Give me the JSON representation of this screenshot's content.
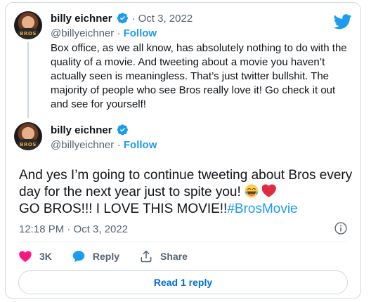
{
  "colors": {
    "accent": "#1d9bf0",
    "text": "#0f1419",
    "muted": "#536471",
    "heart": "#f91880",
    "border": "#cfd9de"
  },
  "parent_tweet": {
    "display_name": "billy eichner",
    "separator": " · ",
    "date": "Oct 3, 2022",
    "handle": "@billyeichner",
    "follow_label": "Follow",
    "avatar_jersey_text": "BROS",
    "text": "Box office, as we all know, has absolutely nothing to do with the quality of a movie. And tweeting about a movie you haven’t actually seen is meaningless. That’s just twitter bullshit. The majority of people who see Bros really love it! Go check it out and see for yourself!"
  },
  "main_tweet": {
    "display_name": "billy eichner",
    "handle": "@billyeichner",
    "follow_label": "Follow",
    "avatar_jersey_text": "BROS",
    "text_part1": "And yes I’m going to continue tweeting about Bros every day for the next year just to spite you! ",
    "text_part2": "GO BROS!!! I LOVE THIS MOVIE!!",
    "hashtag": "#BrosMovie",
    "timestamp": "12:18 PM · Oct 3, 2022"
  },
  "actions": {
    "like_count": "3K",
    "reply_label": "Reply",
    "share_label": "Share"
  },
  "read_replies_label": "Read 1 reply",
  "icons": [
    "twitter-logo-icon",
    "verified-badge-icon",
    "info-icon",
    "heart-icon",
    "reply-bubble-icon",
    "share-icon",
    "laughing-emoji-icon",
    "red-heart-emoji-icon"
  ]
}
